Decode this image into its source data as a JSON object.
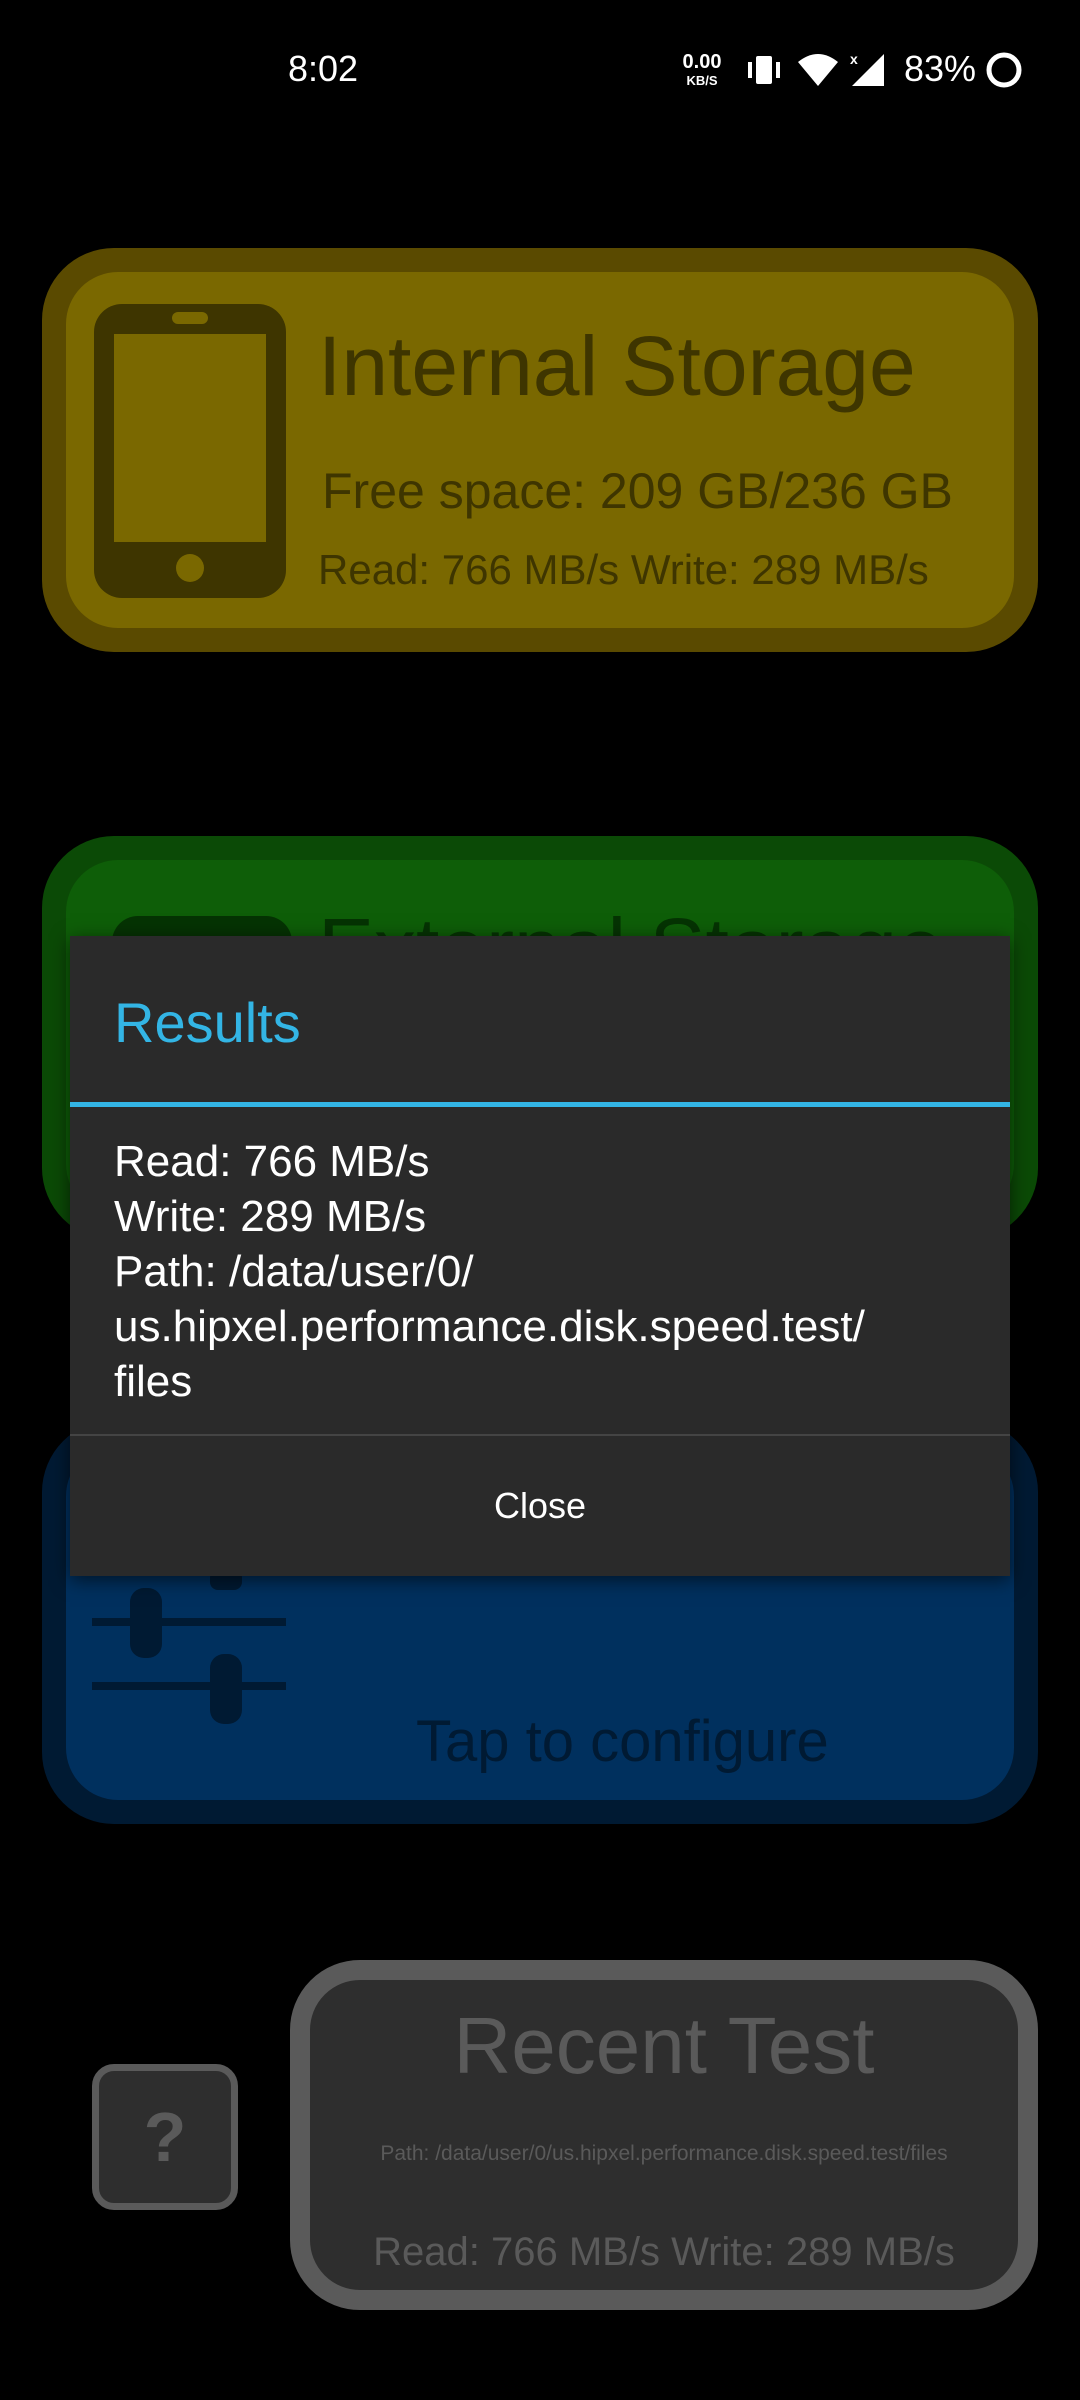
{
  "status_bar": {
    "time": "8:02",
    "net_speed_value": "0.00",
    "net_speed_unit": "KB/S",
    "battery_percent": "83%"
  },
  "internal_storage": {
    "title": "Internal Storage",
    "free_space": "Free space: 209 GB/236 GB",
    "read_write": "Read: 766 MB/s Write: 289 MB/s",
    "color": "#7a6800"
  },
  "external_storage": {
    "title": "External Storage",
    "color": "#0e5e08"
  },
  "configure": {
    "tap_label": "Tap to configure",
    "color": "#00305e"
  },
  "recent_test": {
    "title": "Recent Test",
    "path": "Path: /data/user/0/us.hipxel.performance.disk.speed.test/files",
    "read_write": "Read: 766 MB/s Write: 289 MB/s"
  },
  "help_button": {
    "label": "?"
  },
  "dialog": {
    "title": "Results",
    "accent": "#33b5e5",
    "lines": [
      "Read: 766 MB/s",
      "Write: 289 MB/s",
      "Path: /data/user/0/",
      "us.hipxel.performance.disk.speed.test/",
      "files"
    ],
    "close_label": "Close"
  }
}
